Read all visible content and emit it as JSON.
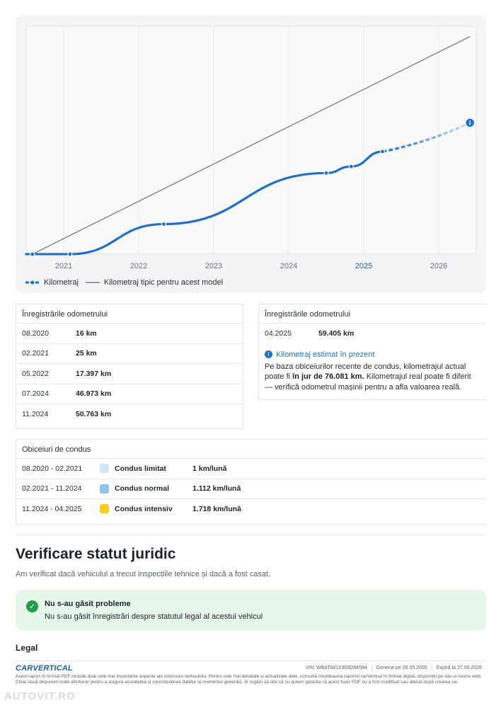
{
  "chart_data": {
    "type": "line",
    "x_ticks": [
      "2021",
      "2022",
      "2023",
      "2024",
      "2025",
      "2026"
    ],
    "highlight_tick": "2025",
    "series": [
      {
        "name": "Kilometraj",
        "kind": "actual",
        "color": "#1a6fd0",
        "points": [
          [
            "08.2020",
            16
          ],
          [
            "02.2021",
            25
          ],
          [
            "05.2022",
            17397
          ],
          [
            "07.2024",
            46973
          ],
          [
            "11.2024",
            50763
          ],
          [
            "04.2025",
            59405
          ]
        ]
      },
      {
        "name": "Kilometraj",
        "kind": "estimated",
        "color": "#1a6fd0",
        "points": [
          [
            "04.2025",
            59405
          ],
          [
            "06.2026",
            76081
          ]
        ]
      },
      {
        "name": "Kilometraj tipic pentru acest model",
        "kind": "typical",
        "color": "#7a7f85",
        "points": [
          [
            "08.2020",
            0
          ],
          [
            "06.2026",
            126000
          ]
        ]
      }
    ],
    "x_range": [
      "2020-07",
      "2026-07"
    ],
    "y_range": [
      0,
      132000
    ],
    "grid": true,
    "legend_position": "bottom-left"
  },
  "legend": {
    "mileage": "Kilometraj",
    "typical": "Kilometraj tipic pentru acest model"
  },
  "odometer_left": {
    "title": "Înregistrările odometrului",
    "rows": [
      {
        "date": "08.2020",
        "value": "16 km"
      },
      {
        "date": "02.2021",
        "value": "25 km"
      },
      {
        "date": "05.2022",
        "value": "17.397 km"
      },
      {
        "date": "07.2024",
        "value": "46.973 km"
      },
      {
        "date": "11.2024",
        "value": "50.763 km"
      }
    ]
  },
  "odometer_right": {
    "title": "Înregistrările odometrului",
    "rows": [
      {
        "date": "04.2025",
        "value": "59.405 km"
      }
    ],
    "estimate_title": "Kilometraj estimat în prezent",
    "estimate_text_1": "Pe baza obiceiurilor recente de condus, kilometrajul actual poate fi ",
    "estimate_bold": "în jur de 76.081 km.",
    "estimate_text_2": " Kilometrajul real poate fi diferit — verifică odometrul mașinii pentru a afla valoarea reală."
  },
  "driving": {
    "title": "Obiceiuri de condus",
    "rows": [
      {
        "period": "08.2020 - 02.2021",
        "label": "Condus limitat",
        "rate": "1 km/lună",
        "color": "#cfe6f7"
      },
      {
        "period": "02.2021 - 11.2024",
        "label": "Condus normal",
        "rate": "1.112 km/lună",
        "color": "#8cc3ef"
      },
      {
        "period": "11.2024 - 04.2025",
        "label": "Condus intensiv",
        "rate": "1.718 km/lună",
        "color": "#f7cc1a"
      }
    ]
  },
  "legal_status": {
    "heading": "Verificare statut juridic",
    "subtitle": "Am verificat dacă vehiculul a trecut inspecțiile tehnice și dacă a fost casat.",
    "result_title": "Nu s-au găsit probleme",
    "result_text": "Nu s-au găsit înregistrări despre statutul legal al acestui vehicul",
    "check_icon": "check-circle-icon"
  },
  "legal_heading": "Legal",
  "footer": {
    "logo": "CARVERTICAL",
    "vin": "VIN:  WBATA610309D94584",
    "generated": "Generat pe  28.05.2026",
    "expires": "Expiră la  27.06.2026",
    "disclaimer": "Acest raport în format PDF include doar cele mai importante aspecte ale istoricului vehiculului. Pentru cele mai detaliate și actualizate date, consultă întotdeauna raportul carVertical în format digital, disponibil pe site-ul nostru web. Chiar dacă depunem toate eforturile pentru a asigura acuratețea și corectitudinea datelor la momentul generării, te rugăm să reții că nu putem garanta că acest fișier PDF nu a fost modificat sau alterat după crearea sa.",
    "watermark": "AUTOVIT.RO"
  },
  "colors": {
    "accent": "#1a6fd0",
    "success": "#1e9e4a",
    "success_bg": "#e6f6ea"
  }
}
